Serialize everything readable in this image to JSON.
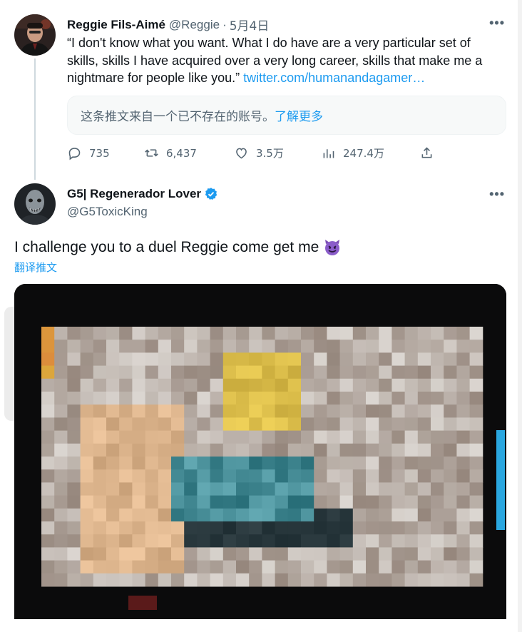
{
  "tweet1": {
    "author_name": "Reggie Fils-Aimé",
    "handle": "@Reggie",
    "separator": "·",
    "date": "5月4日",
    "text": "“I don't know what you want. What I do have are a very particular set of skills, skills I have acquired over a very long career, skills that make me a nightmare for people like you.” ",
    "link_text": "twitter.com/humanandagamer…",
    "quote_notice": "这条推文来自一个已不存在的账号。",
    "learn_more": "了解更多",
    "stats": {
      "replies": "735",
      "retweets": "6,437",
      "likes": "3.5万",
      "views": "247.4万"
    },
    "more_icon": "more-icon"
  },
  "tweet2": {
    "author_name": "G5| Regenerador Lover",
    "handle": "@G5ToxicKing",
    "text": "I challenge you to a duel Reggie come get me",
    "emoji": "smiling-imp-emoji",
    "translate": "翻译推文",
    "more_icon": "more-icon"
  },
  "colors": {
    "accent": "#1d9bf0",
    "secondary_text": "#536471",
    "primary_text": "#0f1419",
    "thread_line": "#cfd9de"
  }
}
